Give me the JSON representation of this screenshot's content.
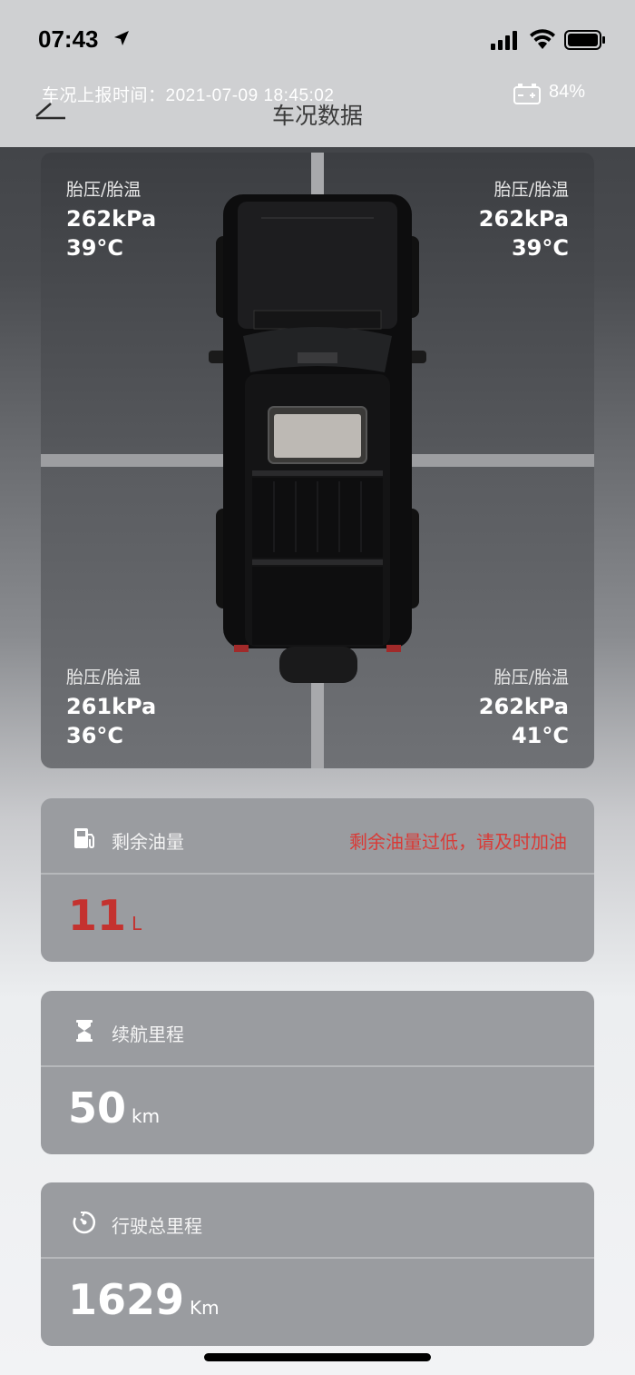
{
  "status_bar": {
    "time": "07:43"
  },
  "header": {
    "report_time": "车况上报时间：2021-07-09 18:45:02",
    "title": "车况数据",
    "battery_percent": "84%"
  },
  "tires": {
    "front_left": {
      "label": "胎压/胎温",
      "pressure": "262kPa",
      "temp": "39°C"
    },
    "front_right": {
      "label": "胎压/胎温",
      "pressure": "262kPa",
      "temp": "39°C"
    },
    "rear_left": {
      "label": "胎压/胎温",
      "pressure": "261kPa",
      "temp": "36°C"
    },
    "rear_right": {
      "label": "胎压/胎温",
      "pressure": "262kPa",
      "temp": "41°C"
    }
  },
  "fuel": {
    "title": "剩余油量",
    "warning": "剩余油量过低，请及时加油",
    "value": "11",
    "unit": "L",
    "warning_color": "#d93a36"
  },
  "range": {
    "title": "续航里程",
    "value": "50",
    "unit": "km"
  },
  "odometer": {
    "title": "行驶总里程",
    "value": "1629",
    "unit": "Km"
  }
}
